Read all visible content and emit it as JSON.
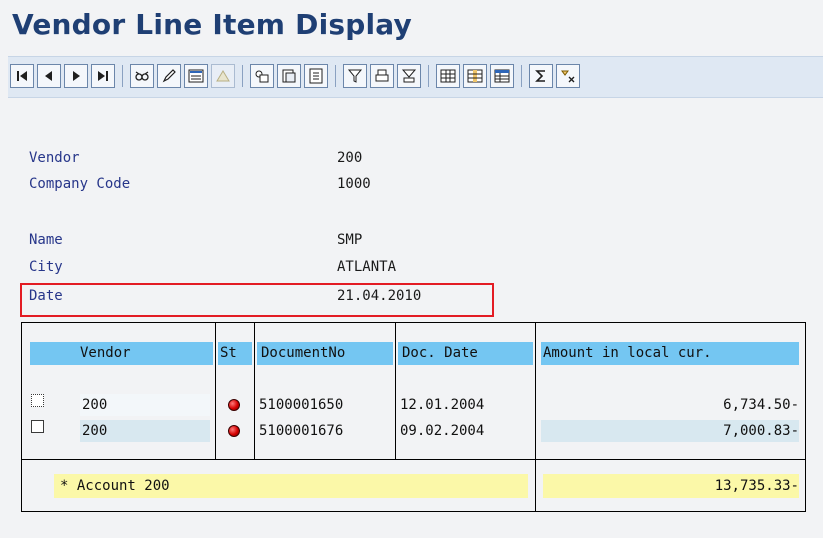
{
  "page": {
    "title": "Vendor Line Item Display"
  },
  "toolbar": {
    "buttons": [
      "first-page-icon",
      "previous-page-icon",
      "next-page-icon",
      "last-page-icon",
      "display-document-icon",
      "change-document-icon",
      "select-layout-icon",
      "mass-change-icon",
      "document-header-icon",
      "select-field-icon",
      "copy-icon",
      "filter-icon",
      "print-icon",
      "subtotal-icon",
      "grid-layout-icon",
      "column-add-icon",
      "column-remove-icon",
      "sum-icon",
      "expand-icon"
    ]
  },
  "header": {
    "vendor_label": "Vendor",
    "vendor_value": "200",
    "company_code_label": "Company Code",
    "company_code_value": "1000",
    "name_label": "Name",
    "name_value": "SMP",
    "city_label": "City",
    "city_value": "ATLANTA",
    "date_label": "Date",
    "date_value": "21.04.2010"
  },
  "table": {
    "columns": [
      "Vendor",
      "St",
      "DocumentNo",
      "Doc. Date",
      "Amount in local cur."
    ],
    "rows": [
      {
        "vendor": "200",
        "status": "red",
        "document_no": "5100001650",
        "doc_date": "12.01.2004",
        "amount": "6,734.50-"
      },
      {
        "vendor": "200",
        "status": "red",
        "document_no": "5100001676",
        "doc_date": "09.02.2004",
        "amount": "7,000.83-"
      }
    ],
    "total": {
      "label": "* Account 200",
      "amount": "13,735.33-"
    }
  },
  "colors": {
    "title": "#1f3f74",
    "header_cell": "#74c6f2",
    "total_row": "#fbf8a8",
    "highlight_box": "#e31b23",
    "status_red": "#d50000"
  }
}
